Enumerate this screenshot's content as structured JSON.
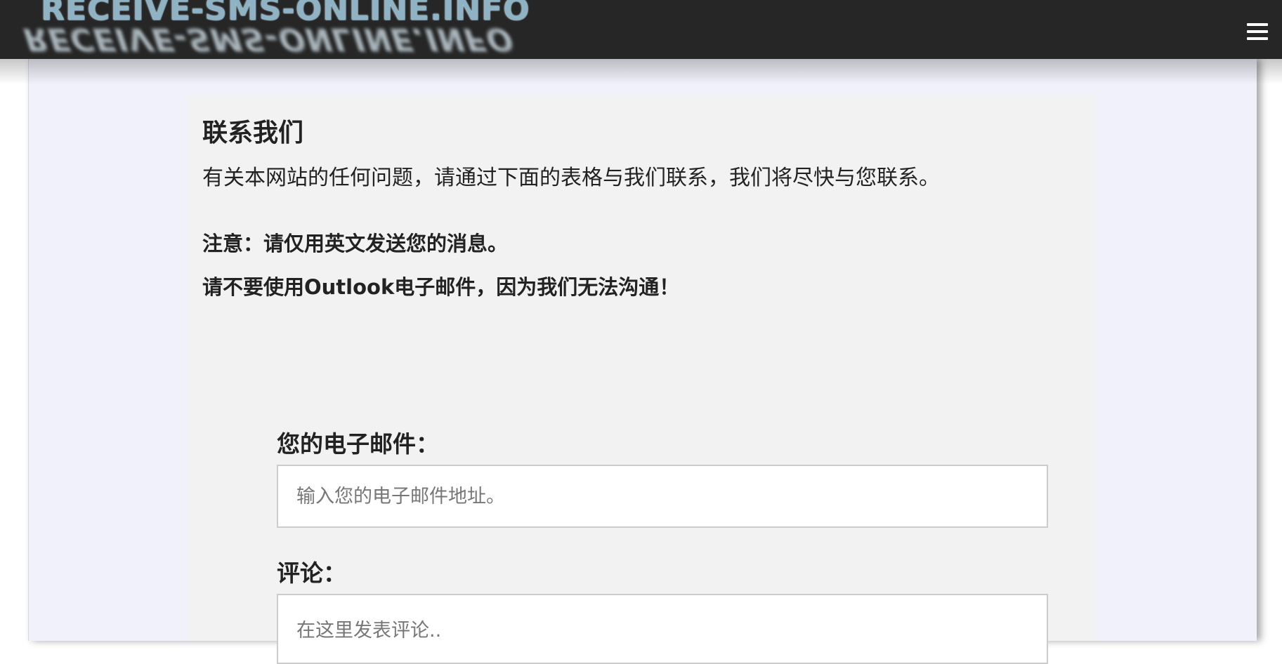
{
  "header": {
    "logo_text": "RECEIVE-SMS-ONLINE.INFO",
    "menu_icon": "hamburger-menu-icon"
  },
  "main": {
    "title": "联系我们",
    "intro": "有关本网站的任何问题，请通过下面的表格与我们联系，我们将尽快与您联系。",
    "notice_1": "注意：请仅用英文发送您的消息。",
    "notice_2": "请不要使用Outlook电子邮件，因为我们无法沟通！"
  },
  "form": {
    "email_label": "您的电子邮件：",
    "email_placeholder": "输入您的电子邮件地址。",
    "comment_label": "评论：",
    "comment_placeholder": "在这里发表评论.."
  },
  "colors": {
    "header_bg": "#262626",
    "page_bg": "#f1f1fb",
    "card_bg": "#f2f2f2"
  }
}
